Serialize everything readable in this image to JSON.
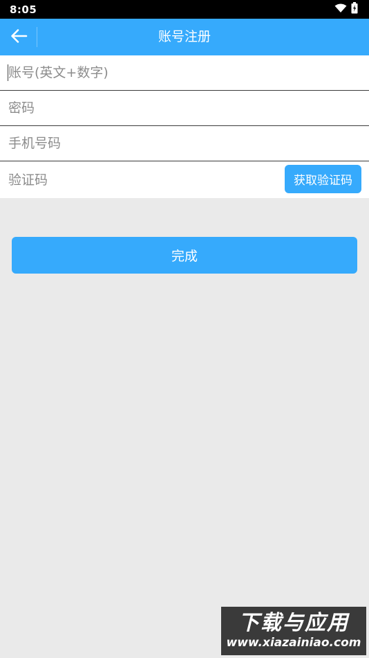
{
  "status_bar": {
    "time": "8:05",
    "icons": [
      "wifi-icon",
      "battery-icon"
    ]
  },
  "app_bar": {
    "title": "账号注册",
    "back_icon": "arrow-left-icon"
  },
  "form": {
    "account": {
      "placeholder": "账号(英文+数字)",
      "value": ""
    },
    "password": {
      "placeholder": "密码",
      "value": ""
    },
    "phone": {
      "placeholder": "手机号码",
      "value": ""
    },
    "verification_code": {
      "placeholder": "验证码",
      "value": "",
      "button_label": "获取验证码"
    }
  },
  "submit_label": "完成",
  "watermark": {
    "logo_text": "下载与应用",
    "url": "www.xiazainiao.com"
  },
  "colors": {
    "accent": "#36aafc",
    "background": "#eaeaea",
    "status_bar": "#000000"
  }
}
